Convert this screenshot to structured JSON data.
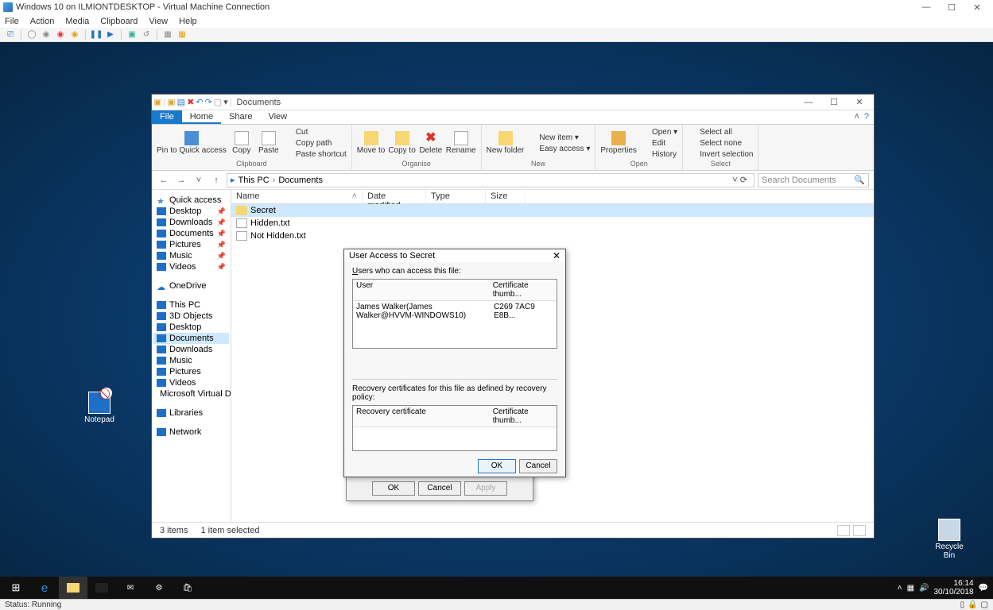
{
  "host": {
    "title": "Windows 10 on ILMIONTDESKTOP - Virtual Machine Connection",
    "menus": [
      "File",
      "Action",
      "Media",
      "Clipboard",
      "View",
      "Help"
    ],
    "status": "Status: Running"
  },
  "desktop": {
    "icons": {
      "notepad": "Notepad",
      "recyclebin": "Recycle Bin"
    }
  },
  "explorer": {
    "title": "Documents",
    "tabs": {
      "file": "File",
      "home": "Home",
      "share": "Share",
      "view": "View"
    },
    "ribbon": {
      "clipboard": {
        "pin": "Pin to Quick access",
        "copy": "Copy",
        "paste": "Paste",
        "cut": "Cut",
        "copypath": "Copy path",
        "pasteshortcut": "Paste shortcut",
        "label": "Clipboard"
      },
      "organise": {
        "moveto": "Move to",
        "copyto": "Copy to",
        "delete": "Delete",
        "rename": "Rename",
        "label": "Organise"
      },
      "new": {
        "newfolder": "New folder",
        "newitem": "New item",
        "easyaccess": "Easy access",
        "label": "New"
      },
      "open": {
        "properties": "Properties",
        "open": "Open",
        "edit": "Edit",
        "history": "History",
        "label": "Open"
      },
      "select": {
        "all": "Select all",
        "none": "Select none",
        "invert": "Invert selection",
        "label": "Select"
      }
    },
    "breadcrumb": {
      "thispc": "This PC",
      "documents": "Documents"
    },
    "search_placeholder": "Search Documents",
    "nav": {
      "quickaccess": "Quick access",
      "desktop": "Desktop",
      "downloads": "Downloads",
      "documents": "Documents",
      "pictures": "Pictures",
      "music": "Music",
      "videos": "Videos",
      "onedrive": "OneDrive",
      "thispc": "This PC",
      "objects3d": "3D Objects",
      "msvirtual": "Microsoft Virtual Di",
      "libraries": "Libraries",
      "network": "Network"
    },
    "columns": {
      "name": "Name",
      "date": "Date modified",
      "type": "Type",
      "size": "Size"
    },
    "files": [
      {
        "name": "Secret",
        "kind": "folder",
        "selected": true
      },
      {
        "name": "Hidden.txt",
        "kind": "file"
      },
      {
        "name": "Not Hidden.txt",
        "kind": "file"
      }
    ],
    "status": {
      "items": "3 items",
      "selected": "1 item selected"
    }
  },
  "props": {
    "ok": "OK",
    "cancel": "Cancel",
    "apply": "Apply"
  },
  "access": {
    "title": "User Access to Secret",
    "users_label": "Users who can access this file:",
    "col_user": "User",
    "col_cert": "Certificate thumb...",
    "user_row": {
      "name": "James Walker(James Walker@HVVM-WINDOWS10)",
      "cert": "C269 7AC9 E8B..."
    },
    "recovery_label": "Recovery certificates for this file as defined by recovery policy:",
    "col_recov": "Recovery certificate",
    "ok": "OK",
    "cancel": "Cancel"
  },
  "taskbar": {
    "clock_time": "16:14",
    "clock_date": "30/10/2018"
  }
}
